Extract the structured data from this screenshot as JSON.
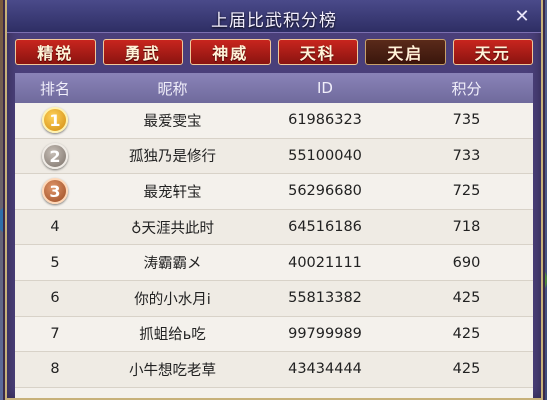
{
  "window": {
    "title": "上届比武积分榜",
    "close_label": "✕"
  },
  "tabs": [
    {
      "label": "精锐",
      "active": false
    },
    {
      "label": "勇武",
      "active": false
    },
    {
      "label": "神威",
      "active": false
    },
    {
      "label": "天科",
      "active": false
    },
    {
      "label": "天启",
      "active": true
    },
    {
      "label": "天元",
      "active": false
    }
  ],
  "table": {
    "headers": [
      "排名",
      "昵称",
      "ID",
      "积分"
    ],
    "rows": [
      {
        "rank": "1",
        "medal": true,
        "name": "最爱雯宝",
        "id": "61986323",
        "score": "735"
      },
      {
        "rank": "2",
        "medal": true,
        "name": "孤独乃是修行",
        "id": "55100040",
        "score": "733"
      },
      {
        "rank": "3",
        "medal": true,
        "name": "最宠轩宝",
        "id": "56296680",
        "score": "725"
      },
      {
        "rank": "4",
        "medal": false,
        "name": "♁天涯共此时",
        "id": "64516186",
        "score": "718"
      },
      {
        "rank": "5",
        "medal": false,
        "name": "涛霸霸メ",
        "id": "40021111",
        "score": "690"
      },
      {
        "rank": "6",
        "medal": false,
        "name": "你的小水月i",
        "id": "55813382",
        "score": "425"
      },
      {
        "rank": "7",
        "medal": false,
        "name": "抓蛆给ь吃",
        "id": "99799989",
        "score": "425"
      },
      {
        "rank": "8",
        "medal": false,
        "name": "小牛想吃老草",
        "id": "43434444",
        "score": "425"
      }
    ]
  },
  "colors": {
    "tab_active": "#3a160c",
    "tab_inactive": "#b21e18",
    "header_bg": "#7a74aa"
  }
}
